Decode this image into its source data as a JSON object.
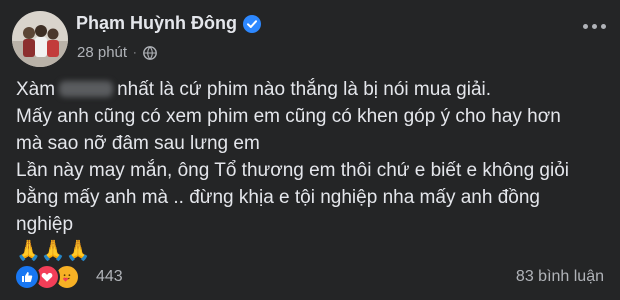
{
  "post": {
    "author": "Phạm Huỳnh Đông",
    "timestamp": "28 phút",
    "privacy_icon": "globe-icon",
    "verified_icon": "verified-badge-icon",
    "menu_icon": "more-options-icon",
    "lines": {
      "l1_before": "Xàm",
      "l1_after": "nhất là cứ phim nào thắng là bị nói mua giải.",
      "l2": "Mấy anh cũng có xem phim em cũng có khen góp ý cho hay hơn",
      "l3": "mà sao nỡ đâm sau lưng em",
      "l4": "Lần này may mắn, ông Tổ thương em thôi chứ e biết e không giỏi",
      "l5": "bằng mấy anh mà .. đừng khịa e tội nghiệp nha mấy anh đồng",
      "l6": "nghiệp",
      "emoji": "🙏🙏🙏"
    },
    "reactions": {
      "types": [
        "like",
        "love",
        "care"
      ],
      "colors": {
        "like": "#1877f2",
        "love": "#f33e58",
        "care": "#f7b125"
      },
      "count": "443"
    },
    "comments": "83 bình luận"
  }
}
